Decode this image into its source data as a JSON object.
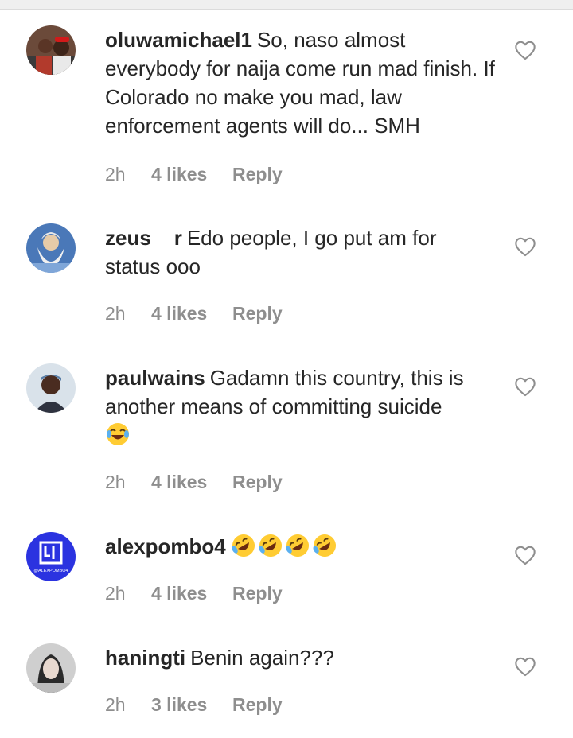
{
  "comments": [
    {
      "username": "oluwamichael1",
      "body": "So, naso almost everybody for naija come run mad finish. If Colorado no make you mad, law enforcement agents will do... SMH",
      "time": "2h",
      "likes": "4 likes",
      "reply": "Reply",
      "avatar_icon": "avatar-photo"
    },
    {
      "username": "zeus__r",
      "body": "Edo people, I go put am for status ooo",
      "time": "2h",
      "likes": "4 likes",
      "reply": "Reply",
      "avatar_icon": "avatar-zeus"
    },
    {
      "username": "paulwains",
      "body": "Gadamn this country, this is another means of committing suicide",
      "emoji": "face-with-tears-of-joy",
      "time": "2h",
      "likes": "4 likes",
      "reply": "Reply",
      "avatar_icon": "avatar-photo"
    },
    {
      "username": "alexpombo4",
      "body": "",
      "emoji": "rolling-on-the-floor-laughing x4",
      "time": "2h",
      "likes": "4 likes",
      "reply": "Reply",
      "avatar_icon": "avatar-logo",
      "avatar_text": "@ALEXPOMBO4"
    },
    {
      "username": "haningti",
      "body": "Benin again???",
      "time": "2h",
      "likes": "3 likes",
      "reply": "Reply",
      "avatar_icon": "avatar-photo"
    }
  ],
  "icons": {
    "like": "heart-outline-icon"
  },
  "colors": {
    "text": "#262626",
    "meta": "#8e8e8e",
    "logo_blue": "#2b33e0"
  }
}
